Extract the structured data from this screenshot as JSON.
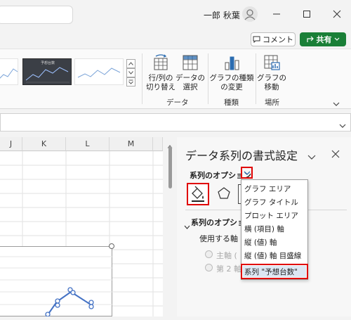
{
  "titlebar": {
    "user_name": "一郎 秋葉"
  },
  "header_actions": {
    "comment_label": "コメント",
    "share_label": "共有"
  },
  "ribbon": {
    "chart_thumb_title": "予想台数",
    "groups": [
      {
        "label": "データ",
        "buttons": [
          {
            "label": "行/列の\n切り替え"
          },
          {
            "label": "データの\n選択"
          }
        ]
      },
      {
        "label": "種類",
        "buttons": [
          {
            "label": "グラフの種類\nの変更"
          }
        ]
      },
      {
        "label": "場所",
        "buttons": [
          {
            "label": "グラフの\n移動"
          }
        ]
      }
    ]
  },
  "sheet": {
    "columns": [
      "J",
      "K",
      "L",
      "M"
    ]
  },
  "pane": {
    "title": "データ系列の書式設定",
    "series_options_label": "系列のオプション",
    "section_title": "系列のオプション",
    "axis_label": "使用する軸",
    "radio_primary": "主軸 (",
    "radio_secondary": "第 2 軸"
  },
  "dropdown_menu": {
    "items": [
      "グラフ エリア",
      "グラフ タイトル",
      "プロット エリア",
      "横 (項目) 軸",
      "縦 (値) 軸",
      "縦 (値) 軸 目盛線",
      "系列 \"予想台数\""
    ],
    "selected_index": 6
  },
  "colors": {
    "accent_red": "#e00000",
    "share_green": "#1a7f37",
    "series_blue": "#4472c4"
  }
}
